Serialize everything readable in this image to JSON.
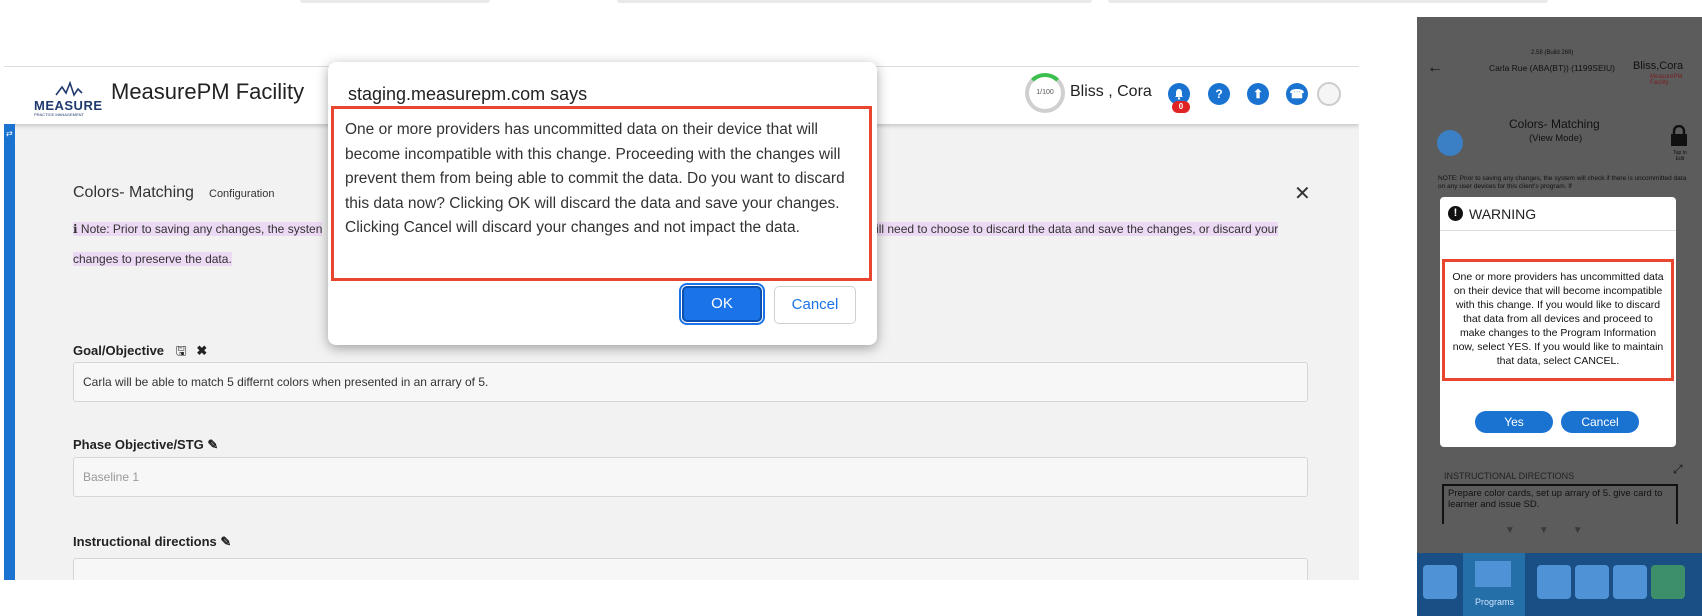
{
  "app": {
    "logo_text": "MEASURE",
    "logo_sub": "PRACTICE MANAGEMENT",
    "title": "MeasurePM Facility",
    "progress_text": "1/100",
    "user_name": "Bliss , Cora",
    "notification_count": "0",
    "help_glyph": "?",
    "upload_glyph": "⬆",
    "phone_glyph": "☎"
  },
  "page": {
    "title": "Colors- Matching",
    "subtitle": "Configuration",
    "note_left": "Note: Prior to saving any changes, the systen",
    "note_right": "will need to choose to discard the data and save the changes, or discard your",
    "note_line2": "changes to preserve the data.",
    "goal_label": "Goal/Objective",
    "goal_value": "Carla will be able to match 5 differnt colors when presented in an arrary of 5.",
    "phase_label": "Phase Objective/STG",
    "phase_placeholder": "Baseline 1",
    "instr_label": "Instructional directions"
  },
  "dialog": {
    "title": "staging.measurepm.com says",
    "message": "One or more providers has uncommitted data on their device that will become incompatible with this change. Proceeding with the changes will prevent them from being able to commit the data. Do you want to discard this data now? Clicking OK will discard the data and save your changes. Clicking Cancel will discard your changes and not impact the data.",
    "ok_label": "OK",
    "cancel_label": "Cancel"
  },
  "phone": {
    "build": "2.58 (Build 269)",
    "client": "Carla Rue (ABA(BT)) (1199SEIU)",
    "user": "Bliss,Cora",
    "facility": "MeasurePM Facility",
    "program_title": "Colors- Matching",
    "view_mode": "(View Mode)",
    "tap_to_edit": "Tap to Edit",
    "note_text": "NOTE: Prior to saving any changes, the system will check if there is uncommitted data on any user devices for this client's program. If",
    "warning_title": "WARNING",
    "warning_message": "One or more providers has uncommitted data on their device that will become incompatible with this change. If you would like to discard that data from all devices and proceed to make changes to the Program Information now, select YES. If you would like to maintain that data, select CANCEL.",
    "yes_label": "Yes",
    "cancel_label": "Cancel",
    "instr_header": "INSTRUCTIONAL DIRECTIONS",
    "instr_text": "Prepare color cards, set up arrary of 5. give card to learner and issue SD.",
    "nav_programs": "Programs"
  },
  "colors": {
    "accent": "#1a73d1",
    "highlight_border": "#e8462f",
    "note_highlight": "#ecd9f4"
  }
}
